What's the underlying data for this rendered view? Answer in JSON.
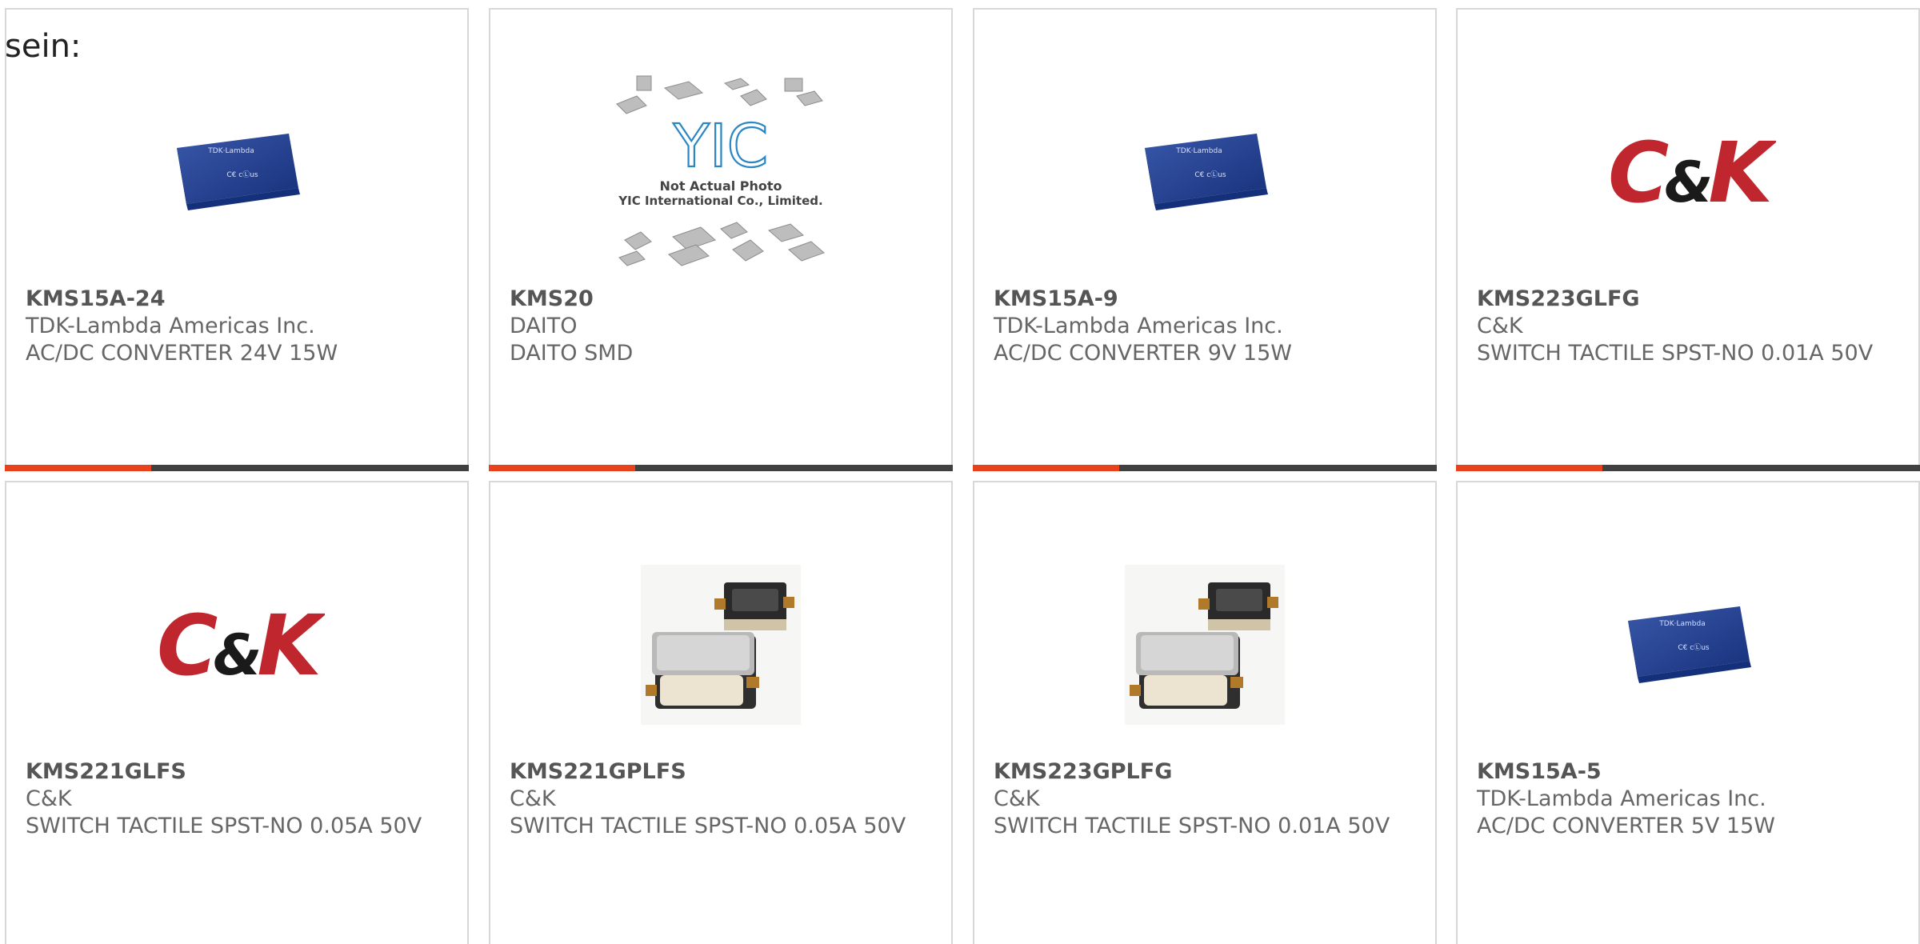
{
  "intro_text": "sein:",
  "colors": {
    "accent": "#e8411b",
    "bar": "#404040",
    "ck_red": "#c0262d",
    "ck_black": "#1a1a1a",
    "module_blue": "#1f3f96"
  },
  "products": [
    {
      "part": "KMS15A-24",
      "manufacturer": "TDK-Lambda Americas Inc.",
      "description": "AC/DC CONVERTER 24V 15W",
      "image": "tdk-module",
      "module_label": "TDK·Lambda",
      "module_marks": "C€ cⓁus"
    },
    {
      "part": "KMS20",
      "manufacturer": "DAITO",
      "description": "DAITO SMD",
      "image": "yic-placeholder",
      "placeholder_logo": "YIC",
      "placeholder_caption_1": "Not Actual Photo",
      "placeholder_caption_2": "YIC International Co., Limited."
    },
    {
      "part": "KMS15A-9",
      "manufacturer": "TDK-Lambda Americas Inc.",
      "description": "AC/DC CONVERTER 9V 15W",
      "image": "tdk-module",
      "module_label": "TDK·Lambda",
      "module_marks": "C€ cⓁus"
    },
    {
      "part": "KMS223GLFG",
      "manufacturer": "C&K",
      "description": "SWITCH TACTILE SPST-NO 0.01A 50V",
      "image": "ck-logo",
      "logo_text": "C&K"
    },
    {
      "part": "KMS221GLFS",
      "manufacturer": "C&K",
      "description": "SWITCH TACTILE SPST-NO 0.05A 50V",
      "image": "ck-logo",
      "logo_text": "C&K"
    },
    {
      "part": "KMS221GPLFS",
      "manufacturer": "C&K",
      "description": "SWITCH TACTILE SPST-NO 0.05A 50V",
      "image": "switch-photo"
    },
    {
      "part": "KMS223GPLFG",
      "manufacturer": "C&K",
      "description": "SWITCH TACTILE SPST-NO 0.01A 50V",
      "image": "switch-photo"
    },
    {
      "part": "KMS15A-5",
      "manufacturer": "TDK-Lambda Americas Inc.",
      "description": "AC/DC CONVERTER 5V 15W",
      "image": "tdk-module",
      "module_label": "TDK·Lambda",
      "module_marks": "C€ cⓁus"
    }
  ]
}
